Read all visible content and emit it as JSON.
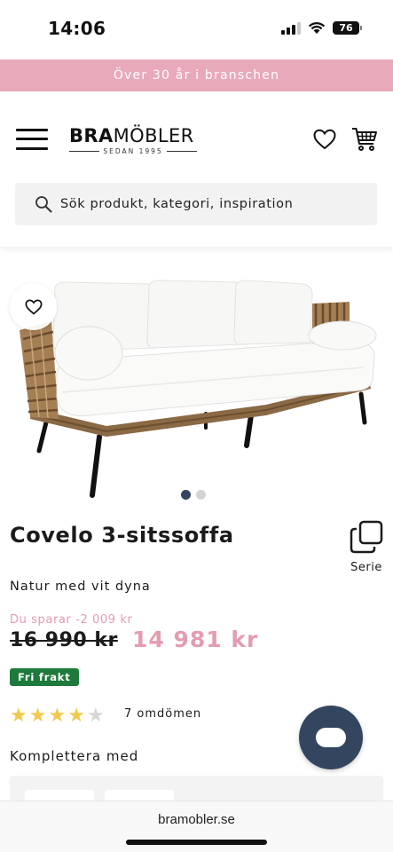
{
  "status_bar": {
    "time": "14:06",
    "battery": "76"
  },
  "promo_banner": {
    "text": "Över 30 år i branschen"
  },
  "header": {
    "logo_bold": "BRA",
    "logo_light": "MÖBLER",
    "logo_tagline": "SEDAN 1995",
    "search_placeholder": "Sök produkt, kategori, inspiration"
  },
  "product": {
    "title": "Covelo 3-sitssoffa",
    "serie_label": "Serie",
    "variant": "Natur med vit dyna",
    "savings": "Du sparar -2 009 kr",
    "old_price": "16 990 kr",
    "new_price": "14 981 kr",
    "shipping_badge": "Fri frakt",
    "rating": 4,
    "rating_max": 5,
    "reviews": "7 omdömen",
    "image_count": 2,
    "image_index": 1
  },
  "complement": {
    "heading": "Komplettera med"
  },
  "browser": {
    "url": "bramobler.se"
  },
  "colors": {
    "promo": "#e8a9bb",
    "sale_price": "#e39cb0",
    "badge": "#1e7a3c",
    "chat_button": "#34465f",
    "star_filled": "#f2c94c",
    "star_empty": "#d6d6d6"
  }
}
